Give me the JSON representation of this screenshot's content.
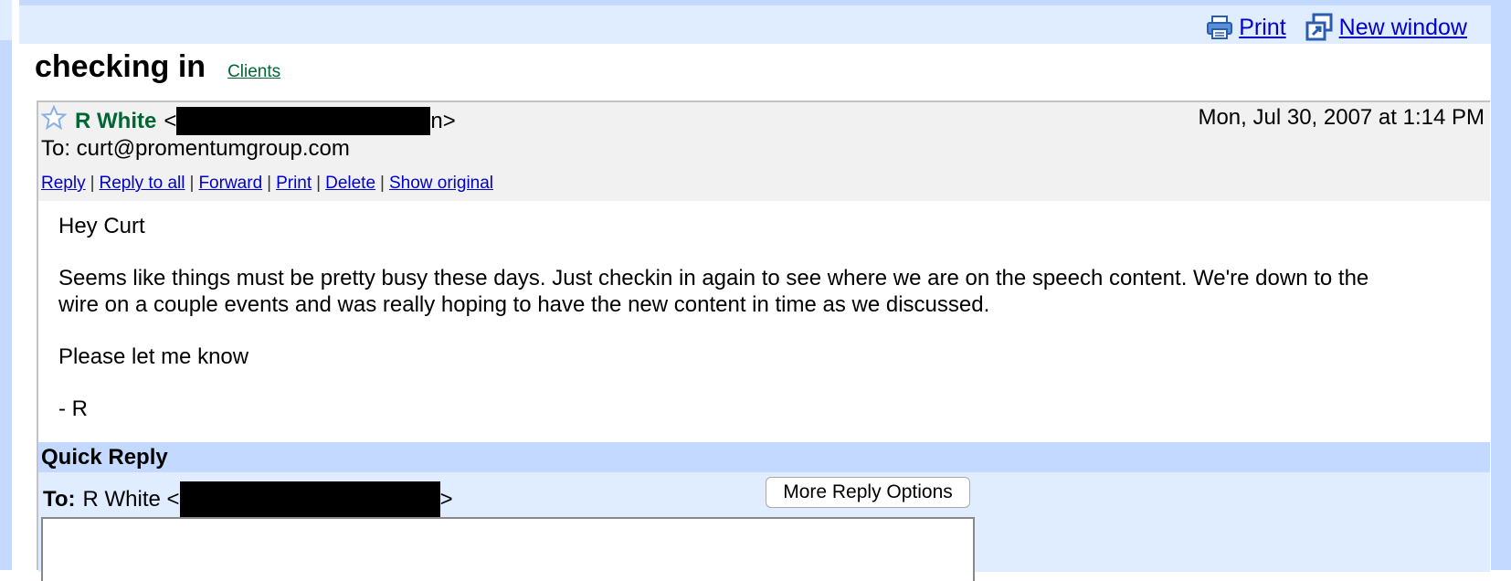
{
  "toolbar": {
    "print_label": "Print",
    "new_window_label": "New window"
  },
  "thread": {
    "subject": "checking in",
    "label": "Clients"
  },
  "message": {
    "sender_name": "R White",
    "sender_open": "<",
    "sender_tail": "n>",
    "date": "Mon, Jul 30, 2007 at 1:14 PM",
    "to_line": "To: curt@promentumgroup.com",
    "actions": [
      "Reply",
      "Reply to all",
      "Forward",
      "Print",
      "Delete",
      "Show original"
    ],
    "body": {
      "greeting": "Hey Curt",
      "paragraph": "Seems like things must be pretty busy these days. Just checkin in again to see where we are on the speech content. We're down to the wire on a couple events and was really hoping to have the new content in time as we discussed.",
      "closing": "Please let me know",
      "signature": "- R"
    }
  },
  "quick_reply": {
    "title": "Quick Reply",
    "to_label": "To:",
    "to_name": "R White <",
    "to_tail": ">",
    "more_options_label": "More Reply Options",
    "reply_text": ""
  },
  "colors": {
    "link": "#0000cc",
    "sender": "#006633",
    "header_bg": "#f1f1f1",
    "frame_bg": "#c3d9ff",
    "quick_reply_bg": "#e0ecff"
  },
  "icons": {
    "print": "printer-icon",
    "new_window": "new-window-icon",
    "star": "star-outline-icon"
  }
}
